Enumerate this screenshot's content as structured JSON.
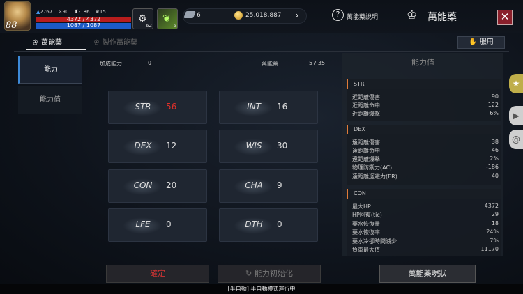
{
  "player": {
    "level": "88",
    "gems": "2767",
    "stat_a": "90",
    "stat_b": "-186",
    "stat_c": "15",
    "hp": "4372 / 4372",
    "mp": "1087 / 1087"
  },
  "slots": [
    {
      "count": "62",
      "icon": "gear-potion-icon"
    },
    {
      "count": "5",
      "icon": "leaf-icon"
    }
  ],
  "currency": {
    "crystals": "6",
    "gold": "25,018,887"
  },
  "header": {
    "help_label": "萬能藥說明",
    "title": "萬能藥"
  },
  "tabs": {
    "tab1": "萬能藥",
    "tab2": "製作萬能藥",
    "use_button": "服用"
  },
  "sidebar": {
    "item1": "能力",
    "item2": "能力值"
  },
  "info": {
    "bonus_label": "加成能力",
    "bonus_value": "0",
    "count_label": "萬能藥",
    "count_value": "5 / 35"
  },
  "stats": [
    {
      "name": "STR",
      "value": "56"
    },
    {
      "name": "INT",
      "value": "16"
    },
    {
      "name": "DEX",
      "value": "12"
    },
    {
      "name": "WIS",
      "value": "30"
    },
    {
      "name": "CON",
      "value": "20"
    },
    {
      "name": "CHA",
      "value": "9"
    },
    {
      "name": "LFE",
      "value": "0"
    },
    {
      "name": "DTH",
      "value": "0"
    }
  ],
  "panel": {
    "title": "能力值",
    "str": {
      "head": "STR",
      "rows": [
        [
          "近距離傷害",
          "90"
        ],
        [
          "近距離命中",
          "122"
        ],
        [
          "近距離爆擊",
          "6%"
        ]
      ]
    },
    "dex": {
      "head": "DEX",
      "rows": [
        [
          "遠距離傷害",
          "38"
        ],
        [
          "遠距離命中",
          "46"
        ],
        [
          "遠距離爆擊",
          "2%"
        ],
        [
          "物理防禦力(AC)",
          "-186"
        ],
        [
          "遠距離迴避力(ER)",
          "40"
        ]
      ]
    },
    "con": {
      "head": "CON",
      "rows": [
        [
          "最大HP",
          "4372"
        ],
        [
          "HP回復(tic)",
          "29"
        ],
        [
          "藥水恢復量",
          "18"
        ],
        [
          "藥水恢復率",
          "24%"
        ],
        [
          "藥水冷卻時間減少",
          "7%"
        ],
        [
          "負重最大值",
          "11170"
        ]
      ]
    }
  },
  "buttons": {
    "b1": "確定",
    "b2": "能力初始化",
    "b3": "萬能藥現狀"
  },
  "status": "[半自動] 半自動模式運行中",
  "colors": {
    "hp": "#b71d1d",
    "mp": "#1c5ac7",
    "accent": "#e07b39",
    "highlight_red": "#e0302a"
  }
}
